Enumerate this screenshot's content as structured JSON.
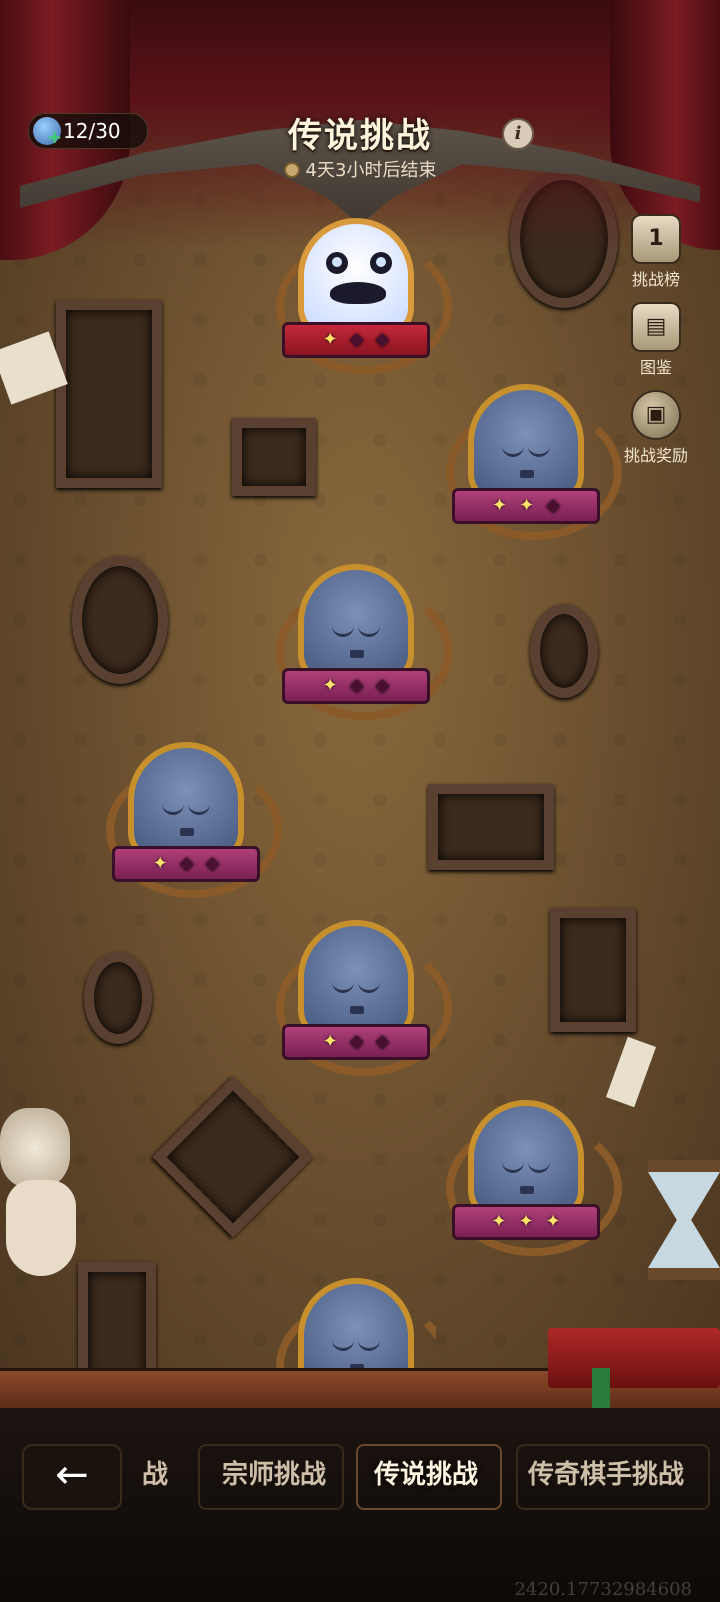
{
  "header": {
    "title": "传说挑战",
    "timer": "4天3小时后结束",
    "info_label": "i",
    "stamina": "12/30"
  },
  "side_menu": [
    {
      "label": "挑战榜",
      "badge": "1",
      "icon": "leaderboard-icon"
    },
    {
      "label": "图鉴",
      "icon": "book-stack-icon"
    },
    {
      "label": "挑战奖励",
      "icon": "gift-icon"
    }
  ],
  "nodes": [
    {
      "type": "boss",
      "stars": 1
    },
    {
      "type": "normal",
      "stars": 2
    },
    {
      "type": "normal",
      "stars": 1
    },
    {
      "type": "normal",
      "stars": 1
    },
    {
      "type": "normal",
      "stars": 1
    },
    {
      "type": "normal",
      "stars": 3
    },
    {
      "type": "normal",
      "stars": 0
    }
  ],
  "bottom_tabs": {
    "partial": "战",
    "tab1": "宗师挑战",
    "tab2": "传说挑战",
    "tab3": "传奇棋手挑战",
    "active": "传说挑战"
  },
  "back_label": "←",
  "version": "2420.17732984608",
  "colors": {
    "star_on": "#ffe26a",
    "ribbon": "#b0407a",
    "boss_ribbon": "#c4283a",
    "frame_gold": "#c8902c"
  }
}
